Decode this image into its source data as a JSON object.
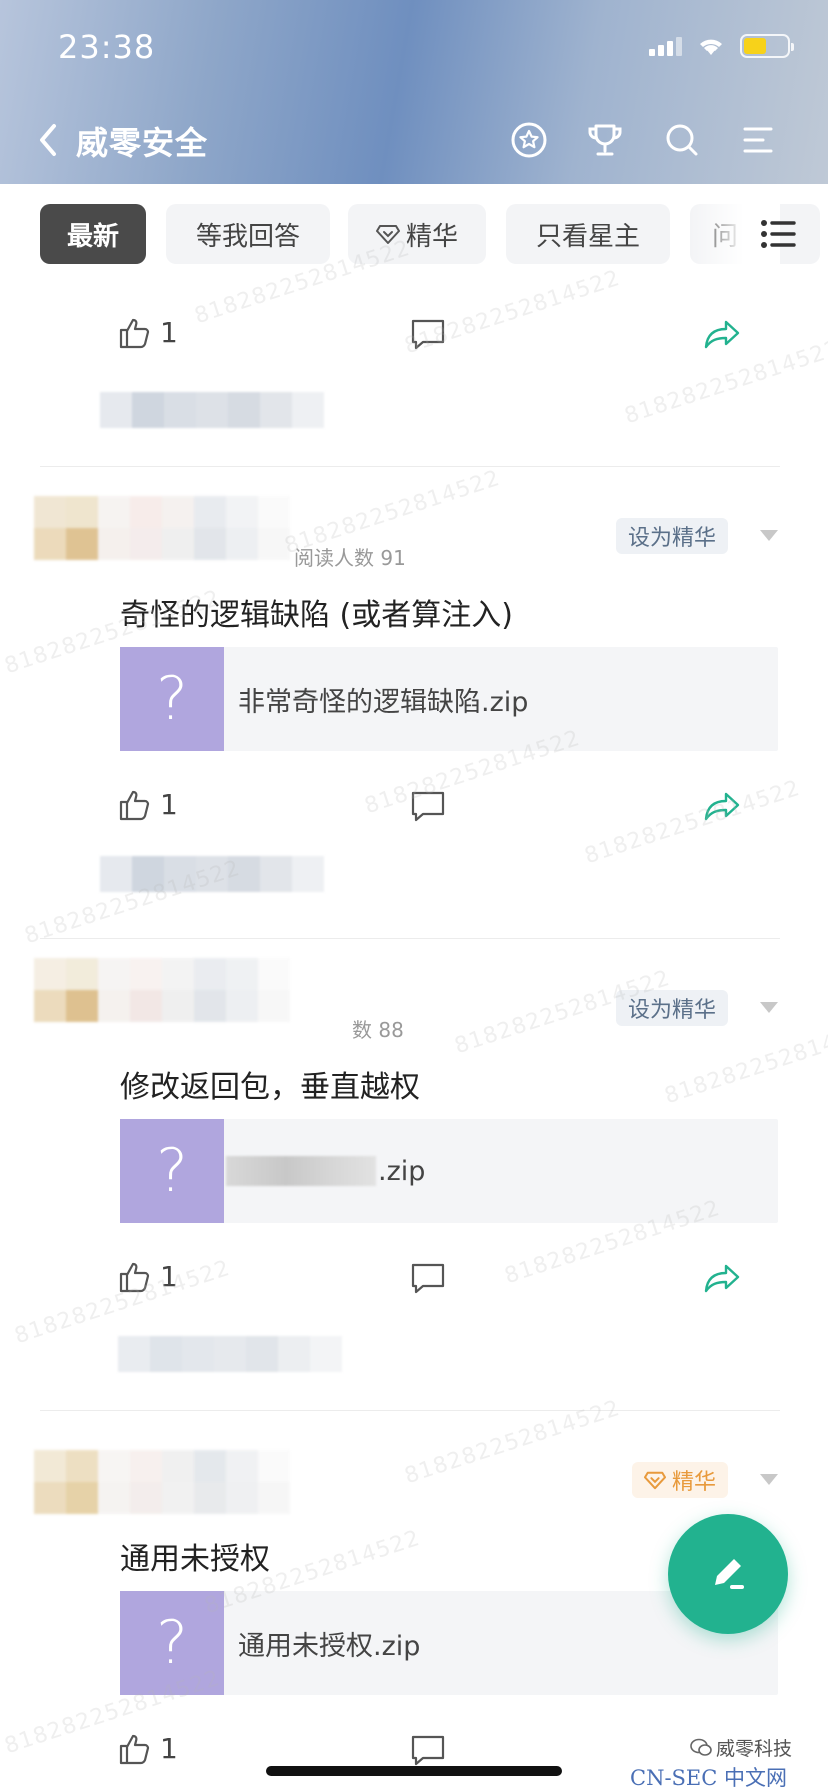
{
  "status_bar": {
    "time": "23:38"
  },
  "nav": {
    "title": "威零安全"
  },
  "tabs": [
    {
      "label": "最新",
      "active": true
    },
    {
      "label": "等我回答",
      "active": false
    },
    {
      "label": "精华",
      "active": false,
      "icon": "diamond-icon"
    },
    {
      "label": "只看星主",
      "active": false
    },
    {
      "label": "问",
      "active": false
    }
  ],
  "posts": [
    {
      "likes": "1"
    },
    {
      "read_count": "阅读人数 91",
      "feature_label": "设为精华",
      "title": "奇怪的逻辑缺陷 (或者算注入)",
      "attachment": {
        "icon_glyph": "?",
        "name": "非常奇怪的逻辑缺陷.zip"
      },
      "likes": "1"
    },
    {
      "read_count": "数 88",
      "feature_label": "设为精华",
      "title": "修改返回包，垂直越权",
      "attachment": {
        "icon_glyph": "?",
        "name": ".zip"
      },
      "likes": "1"
    },
    {
      "feature_label": "精华",
      "featured": true,
      "title": "通用未授权",
      "attachment": {
        "icon_glyph": "?",
        "name": "通用未授权.zip"
      },
      "likes": "1"
    }
  ],
  "watermark": "818282252814522",
  "footer": {
    "brand": "威零科技",
    "site": "CN-SEC 中文网"
  },
  "colors": {
    "accent": "#22b28f",
    "attachment_icon": "#b0a6de",
    "featured": "#e89a3c",
    "active_tab": "#4a4a4a"
  }
}
